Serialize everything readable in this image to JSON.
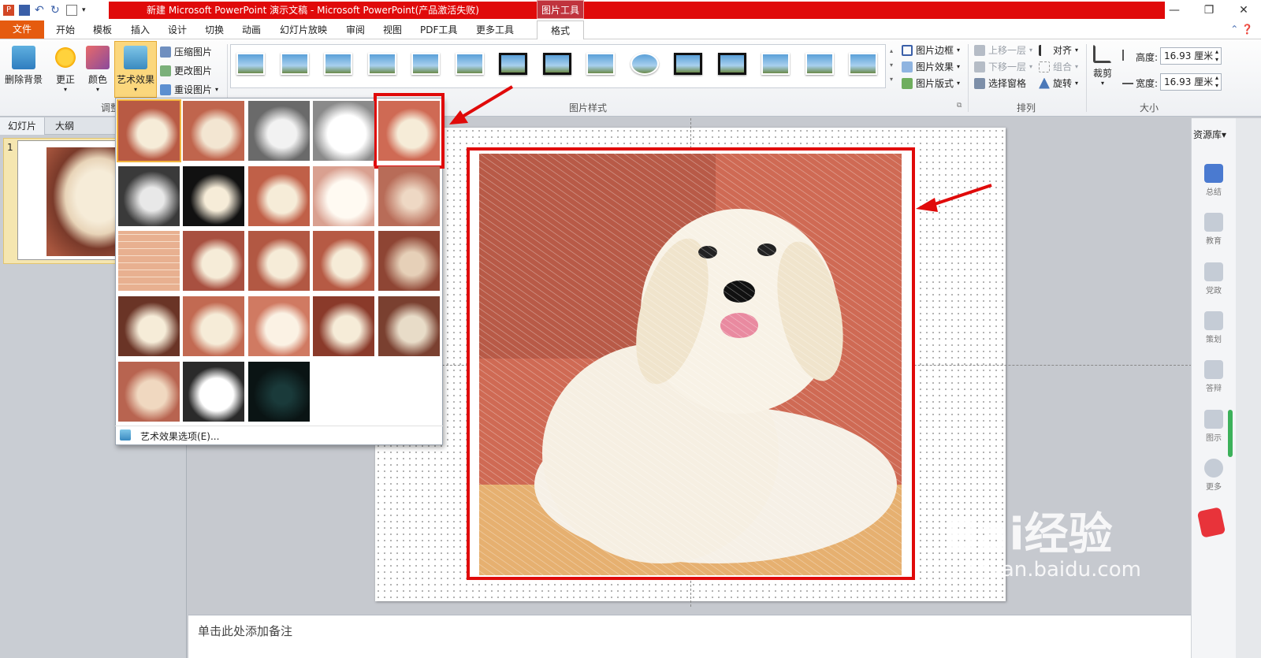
{
  "window": {
    "title": "新建 Microsoft PowerPoint 演示文稿 - Microsoft PowerPoint(产品激活失败)",
    "context_tab": "图片工具"
  },
  "tabs": {
    "file": "文件",
    "items": [
      "开始",
      "模板",
      "插入",
      "设计",
      "切换",
      "动画",
      "幻灯片放映",
      "审阅",
      "视图",
      "PDF工具",
      "更多工具"
    ],
    "format": "格式"
  },
  "ribbon": {
    "remove_bg": "删除背景",
    "corrections": "更正",
    "color": "颜色",
    "artistic": "艺术效果",
    "compress": "压缩图片",
    "change": "更改图片",
    "reset": "重设图片",
    "adjust_group": "调整",
    "styles_group": "图片样式",
    "border": "图片边框",
    "effects": "图片效果",
    "layout": "图片版式",
    "bring_forward": "上移一层",
    "send_backward": "下移一层",
    "selection_pane": "选择窗格",
    "align": "对齐",
    "group": "组合",
    "rotate": "旋转",
    "arrange_group": "排列",
    "crop": "裁剪",
    "height_label": "高度:",
    "height_value": "16.93 厘米",
    "width_label": "宽度:",
    "width_value": "16.93 厘米",
    "size_group": "大小"
  },
  "left": {
    "tab_slides": "幻灯片",
    "tab_outline": "大纲",
    "slide_number": "1"
  },
  "gallery": {
    "options_label": "艺术效果选项(E)..."
  },
  "notes": {
    "placeholder": "单击此处添加备注"
  },
  "rightpanel": {
    "title": "资源库",
    "items": [
      "总结",
      "教育",
      "党政",
      "策划",
      "答辩",
      "图示",
      "更多"
    ]
  },
  "watermark": {
    "line1": "Bai经验",
    "line2": "jingyan.baidu.com"
  }
}
